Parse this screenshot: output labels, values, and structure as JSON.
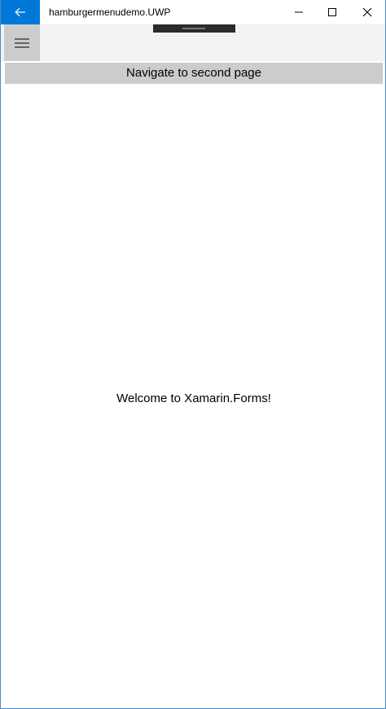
{
  "window": {
    "title": "hamburgermenudemo.UWP",
    "accent_color": "#0078d7",
    "icons": {
      "back": "back-arrow-icon",
      "minimize": "minimize-icon",
      "maximize": "maximize-icon",
      "close": "close-icon"
    }
  },
  "header": {
    "menu_icon": "hamburger-icon"
  },
  "main": {
    "navigate_button_label": "Navigate to second page",
    "welcome_text": "Welcome to Xamarin.Forms!"
  }
}
